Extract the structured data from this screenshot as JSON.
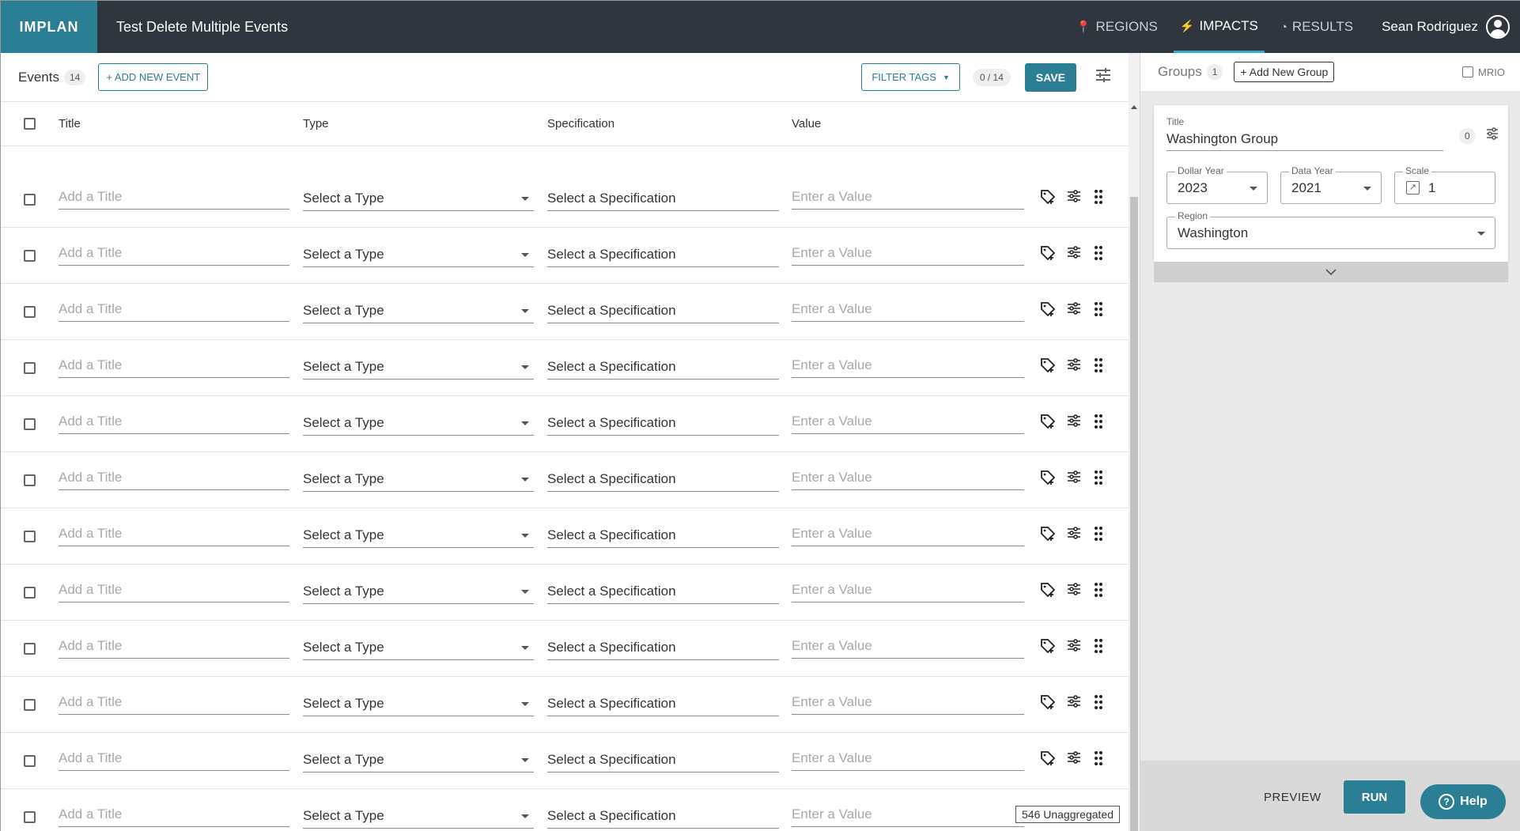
{
  "app": {
    "logo": "IMPLAN",
    "project_title": "Test Delete Multiple Events"
  },
  "nav": {
    "items": [
      {
        "label": "REGIONS",
        "icon": "map-pin-icon",
        "glyph": "📍"
      },
      {
        "label": "IMPACTS",
        "icon": "lightning-icon",
        "glyph": "⚡"
      },
      {
        "label": "RESULTS",
        "icon": "pie-chart-icon",
        "glyph": "◔"
      }
    ],
    "user_name": "Sean Rodriguez"
  },
  "events": {
    "label": "Events",
    "count": "14",
    "add_button": "+ ADD NEW EVENT",
    "filter_tags": "FILTER TAGS",
    "pager": "0 / 14",
    "save_label": "SAVE",
    "columns": {
      "title": "Title",
      "type": "Type",
      "specification": "Specification",
      "value": "Value"
    },
    "row_placeholders": {
      "title": "Add a Title",
      "type": "Select a Type",
      "specification": "Select a Specification",
      "value": "Enter a Value"
    },
    "row_count": 12,
    "unaggregated_tooltip": "546 Unaggregated"
  },
  "groups": {
    "label": "Groups",
    "count": "1",
    "add_button": "+ Add New Group",
    "mrio_label": "MRIO",
    "card": {
      "title_label": "Title",
      "title_value": "Washington Group",
      "event_count": "0",
      "dollar_year_label": "Dollar Year",
      "dollar_year": "2023",
      "data_year_label": "Data Year",
      "data_year": "2021",
      "scale_label": "Scale",
      "scale": "1",
      "region_label": "Region",
      "region": "Washington"
    },
    "preview_label": "PREVIEW",
    "run_label": "RUN",
    "help_label": "Help"
  },
  "colors": {
    "accent": "#2a7f94",
    "topbar": "#2f363d"
  }
}
